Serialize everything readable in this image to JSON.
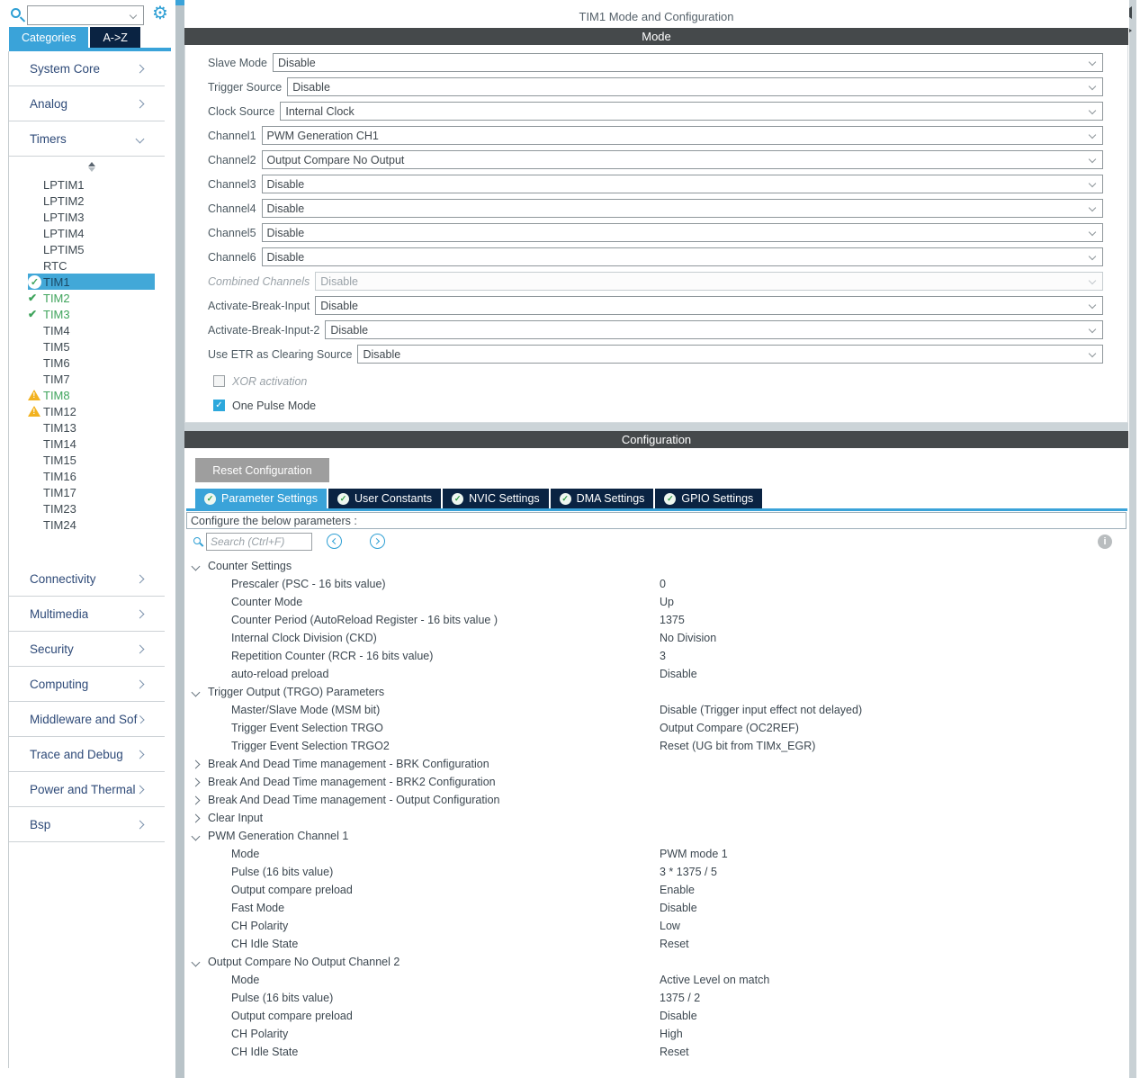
{
  "colors": {
    "accent_blue": "#3aa3d9",
    "dark_navy": "#0a2342",
    "header_gray": "#45494b",
    "check_green": "#3fa45c",
    "warning_yellow": "#f2b21f",
    "selected_row_blue": "#42a8d8",
    "button_gray": "#9e9e9e"
  },
  "sidebar": {
    "search": {
      "value": "",
      "placeholder": ""
    },
    "tabs": [
      {
        "label": "Categories",
        "active": true
      },
      {
        "label": "A->Z",
        "active": false
      }
    ],
    "sections_top": [
      {
        "label": "System Core",
        "state": "collapsed"
      },
      {
        "label": "Analog",
        "state": "collapsed"
      },
      {
        "label": "Timers",
        "state": "expanded"
      }
    ],
    "timers": [
      {
        "label": "LPTIM1",
        "icon": "none"
      },
      {
        "label": "LPTIM2",
        "icon": "none"
      },
      {
        "label": "LPTIM3",
        "icon": "none"
      },
      {
        "label": "LPTIM4",
        "icon": "none"
      },
      {
        "label": "LPTIM5",
        "icon": "none"
      },
      {
        "label": "RTC",
        "icon": "none"
      },
      {
        "label": "TIM1",
        "icon": "check-circle",
        "selected": true
      },
      {
        "label": "TIM2",
        "icon": "check",
        "color": "green"
      },
      {
        "label": "TIM3",
        "icon": "check",
        "color": "green"
      },
      {
        "label": "TIM4",
        "icon": "none"
      },
      {
        "label": "TIM5",
        "icon": "none"
      },
      {
        "label": "TIM6",
        "icon": "none"
      },
      {
        "label": "TIM7",
        "icon": "none"
      },
      {
        "label": "TIM8",
        "icon": "warning",
        "color": "green"
      },
      {
        "label": "TIM12",
        "icon": "warning"
      },
      {
        "label": "TIM13",
        "icon": "none"
      },
      {
        "label": "TIM14",
        "icon": "none"
      },
      {
        "label": "TIM15",
        "icon": "none"
      },
      {
        "label": "TIM16",
        "icon": "none"
      },
      {
        "label": "TIM17",
        "icon": "none"
      },
      {
        "label": "TIM23",
        "icon": "none"
      },
      {
        "label": "TIM24",
        "icon": "none"
      }
    ],
    "sections_bottom": [
      {
        "label": "Connectivity"
      },
      {
        "label": "Multimedia"
      },
      {
        "label": "Security"
      },
      {
        "label": "Computing"
      },
      {
        "label": "Middleware and Sof..."
      },
      {
        "label": "Trace and Debug"
      },
      {
        "label": "Power and Thermal"
      },
      {
        "label": "Bsp"
      }
    ]
  },
  "main": {
    "title": "TIM1 Mode and Configuration",
    "mode": {
      "header": "Mode",
      "rows": [
        {
          "label": "Slave Mode",
          "value": "Disable"
        },
        {
          "label": "Trigger Source",
          "value": "Disable"
        },
        {
          "label": "Clock Source",
          "value": "Internal Clock"
        },
        {
          "label": "Channel1",
          "value": "PWM Generation CH1"
        },
        {
          "label": "Channel2",
          "value": "Output Compare No Output"
        },
        {
          "label": "Channel3",
          "value": "Disable"
        },
        {
          "label": "Channel4",
          "value": "Disable"
        },
        {
          "label": "Channel5",
          "value": "Disable"
        },
        {
          "label": "Channel6",
          "value": "Disable"
        },
        {
          "label": "Combined Channels",
          "value": "Disable",
          "disabled": true
        },
        {
          "label": "Activate-Break-Input",
          "value": "Disable"
        },
        {
          "label": "Activate-Break-Input-2",
          "value": "Disable"
        },
        {
          "label": "Use ETR as Clearing Source",
          "value": "Disable"
        }
      ],
      "checkboxes": [
        {
          "label": "XOR activation",
          "checked": false,
          "disabled": true
        },
        {
          "label": "One Pulse Mode",
          "checked": true,
          "disabled": false
        }
      ]
    },
    "configuration": {
      "header": "Configuration",
      "reset_button": "Reset Configuration",
      "tabs": [
        {
          "label": "Parameter Settings",
          "active": true
        },
        {
          "label": "User Constants",
          "active": false
        },
        {
          "label": "NVIC Settings",
          "active": false
        },
        {
          "label": "DMA Settings",
          "active": false
        },
        {
          "label": "GPIO Settings",
          "active": false
        }
      ],
      "banner": "Configure the below parameters :",
      "search_placeholder": "Search (Ctrl+F)",
      "tree": [
        {
          "label": "Counter Settings",
          "state": "expanded",
          "children": [
            {
              "label": "Prescaler (PSC - 16 bits value)",
              "value": "0"
            },
            {
              "label": "Counter Mode",
              "value": "Up"
            },
            {
              "label": "Counter Period (AutoReload Register - 16 bits value )",
              "value": "1375"
            },
            {
              "label": "Internal Clock Division (CKD)",
              "value": "No Division"
            },
            {
              "label": "Repetition Counter (RCR - 16 bits value)",
              "value": "3"
            },
            {
              "label": "auto-reload preload",
              "value": "Disable"
            }
          ]
        },
        {
          "label": "Trigger Output (TRGO) Parameters",
          "state": "expanded",
          "children": [
            {
              "label": "Master/Slave Mode (MSM bit)",
              "value": "Disable (Trigger input effect not delayed)"
            },
            {
              "label": "Trigger Event Selection TRGO",
              "value": "Output Compare (OC2REF)"
            },
            {
              "label": "Trigger Event Selection TRGO2",
              "value": "Reset (UG bit from TIMx_EGR)"
            }
          ]
        },
        {
          "label": "Break And Dead Time management - BRK Configuration",
          "state": "collapsed",
          "children": []
        },
        {
          "label": "Break And Dead Time management - BRK2 Configuration",
          "state": "collapsed",
          "children": []
        },
        {
          "label": "Break And Dead Time management - Output Configuration",
          "state": "collapsed",
          "children": []
        },
        {
          "label": "Clear Input",
          "state": "collapsed",
          "children": []
        },
        {
          "label": "PWM Generation Channel 1",
          "state": "expanded",
          "children": [
            {
              "label": "Mode",
              "value": "PWM mode 1"
            },
            {
              "label": "Pulse (16 bits value)",
              "value": "3 * 1375 / 5"
            },
            {
              "label": "Output compare preload",
              "value": "Enable"
            },
            {
              "label": "Fast Mode",
              "value": "Disable"
            },
            {
              "label": "CH Polarity",
              "value": "Low"
            },
            {
              "label": "CH Idle State",
              "value": "Reset"
            }
          ]
        },
        {
          "label": "Output Compare No Output Channel 2",
          "state": "expanded",
          "children": [
            {
              "label": "Mode",
              "value": "Active Level on match"
            },
            {
              "label": "Pulse (16 bits value)",
              "value": "1375 / 2"
            },
            {
              "label": "Output compare preload",
              "value": "Disable"
            },
            {
              "label": "CH Polarity",
              "value": "High"
            },
            {
              "label": "CH Idle State",
              "value": "Reset"
            }
          ]
        }
      ]
    }
  }
}
